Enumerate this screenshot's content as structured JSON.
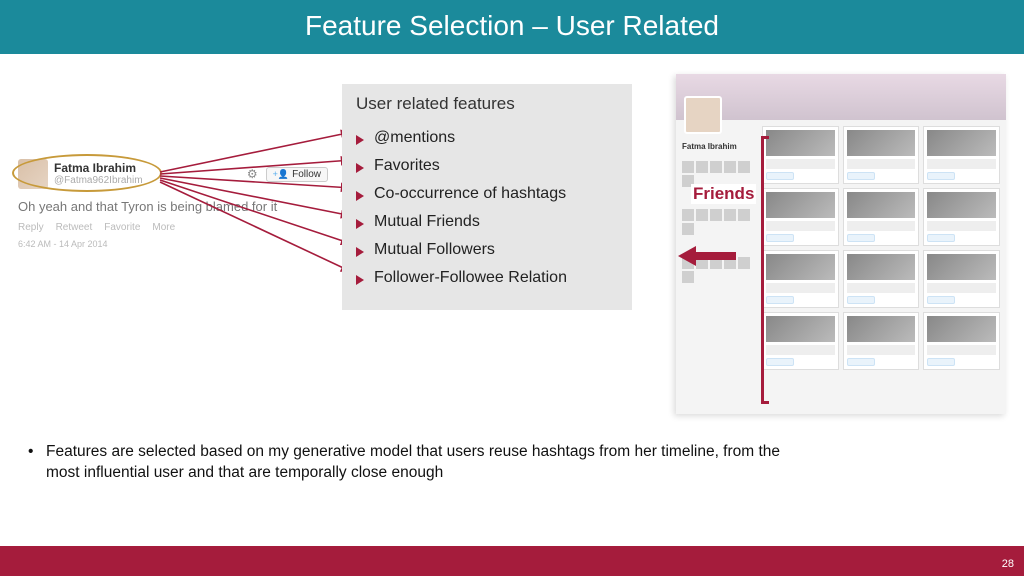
{
  "header": {
    "title": "Feature Selection – User Related"
  },
  "tweet": {
    "user_name": "Fatma Ibrahim",
    "user_handle": "@Fatma962Ibrahim",
    "follow_label": "Follow",
    "text": "Oh yeah and that Tyron is being blamed for it",
    "actions": {
      "reply": "Reply",
      "retweet": "Retweet",
      "favorite": "Favorite",
      "more": "More"
    },
    "timestamp": "6:42 AM - 14 Apr 2014"
  },
  "features": {
    "title": "User related features",
    "items": [
      "@mentions",
      "Favorites",
      "Co-occurrence of hashtags",
      "Mutual Friends",
      "Mutual Followers",
      "Follower-Followee Relation"
    ]
  },
  "profile": {
    "name": "Fatma Ibrahim",
    "friends_label": "Friends"
  },
  "paragraph": "Features are selected based  on my generative model that users reuse hashtags from her timeline, from the most influential user and that are temporally close enough",
  "page_number": "28",
  "colors": {
    "teal": "#1b8a9b",
    "maroon": "#a51c3c",
    "ochre": "#c79a3a"
  }
}
